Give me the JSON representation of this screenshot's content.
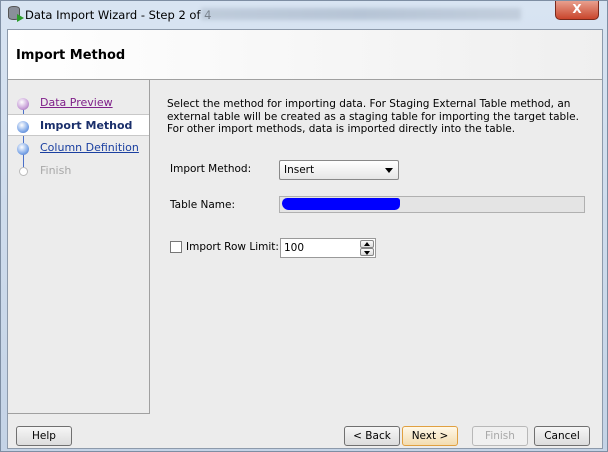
{
  "window": {
    "title": "Data Import Wizard - Step 2 of 4",
    "close_label": "X"
  },
  "header": {
    "title": "Import Method"
  },
  "steps": [
    {
      "label": "Data Preview",
      "state": "visited"
    },
    {
      "label": "Import Method",
      "state": "current"
    },
    {
      "label": "Column Definition",
      "state": "link"
    },
    {
      "label": "Finish",
      "state": "disabled"
    }
  ],
  "main": {
    "description": "Select the method for importing data.  For Staging External Table method, an external table will be created as a staging table for importing the target table.  For other import methods, data is imported directly into the table.",
    "import_method_label": "Import Method:",
    "import_method_value": "Insert",
    "table_name_label": "Table Name:",
    "row_limit_label": "Import Row Limit:",
    "row_limit_value": "100",
    "row_limit_checked": false
  },
  "buttons": {
    "help": "Help",
    "back": "< Back",
    "next": "Next >",
    "finish": "Finish",
    "cancel": "Cancel"
  }
}
